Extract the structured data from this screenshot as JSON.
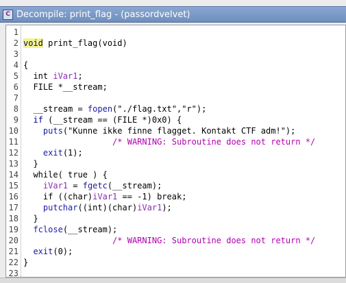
{
  "window": {
    "title": "Decompile: print_flag -  (passordvelvet)",
    "app_icon": "ghidra-decompiler-icon",
    "icon_glyph": "C"
  },
  "line_numbers": [
    "1",
    "2",
    "3",
    "4",
    "5",
    "6",
    "7",
    "8",
    "9",
    "10",
    "11",
    "12",
    "13",
    "14",
    "15",
    "16",
    "17",
    "18",
    "19",
    "20",
    "21",
    "22",
    "23"
  ],
  "code": {
    "l2": {
      "kw": "void",
      "text": " print_flag(void)"
    },
    "l4": "{",
    "l5": {
      "a": "  int ",
      "v": "iVar1",
      ";": ";"
    },
    "l6": "  FILE *__stream;",
    "l8": {
      "a": "  __stream = ",
      "f": "fopen",
      "b": "(\"./flag.txt\",\"r\");"
    },
    "l9": {
      "a": "  if ",
      "b": "(__stream == (FILE *)0x0) {"
    },
    "l10": {
      "f": "puts",
      "b": "(\"Kunne ikke finne flagget. Kontakt CTF adm!\");"
    },
    "l11": "/* WARNING: Subroutine does not return */",
    "l12": {
      "f": "exit",
      "b": "(1);"
    },
    "l13": "  }",
    "l14": {
      "a": "  while( true ) {"
    },
    "l15": {
      "v": "iVar1",
      "b": " = ",
      "f": "fgetc",
      "c": "(__stream);"
    },
    "l16": {
      "a": "if ((char)",
      "v": "iVar1",
      "b": " == -1) break;"
    },
    "l17": {
      "f": "putchar",
      "b": "((int)(char)",
      "v": "iVar1",
      "c": ");"
    },
    "l18": "  }",
    "l19": {
      "f": "fclose",
      "b": "(__stream);"
    },
    "l20": "/* WARNING: Subroutine does not return */",
    "l21": {
      "f": "exit",
      "b": "(0);"
    },
    "l22": "}"
  }
}
